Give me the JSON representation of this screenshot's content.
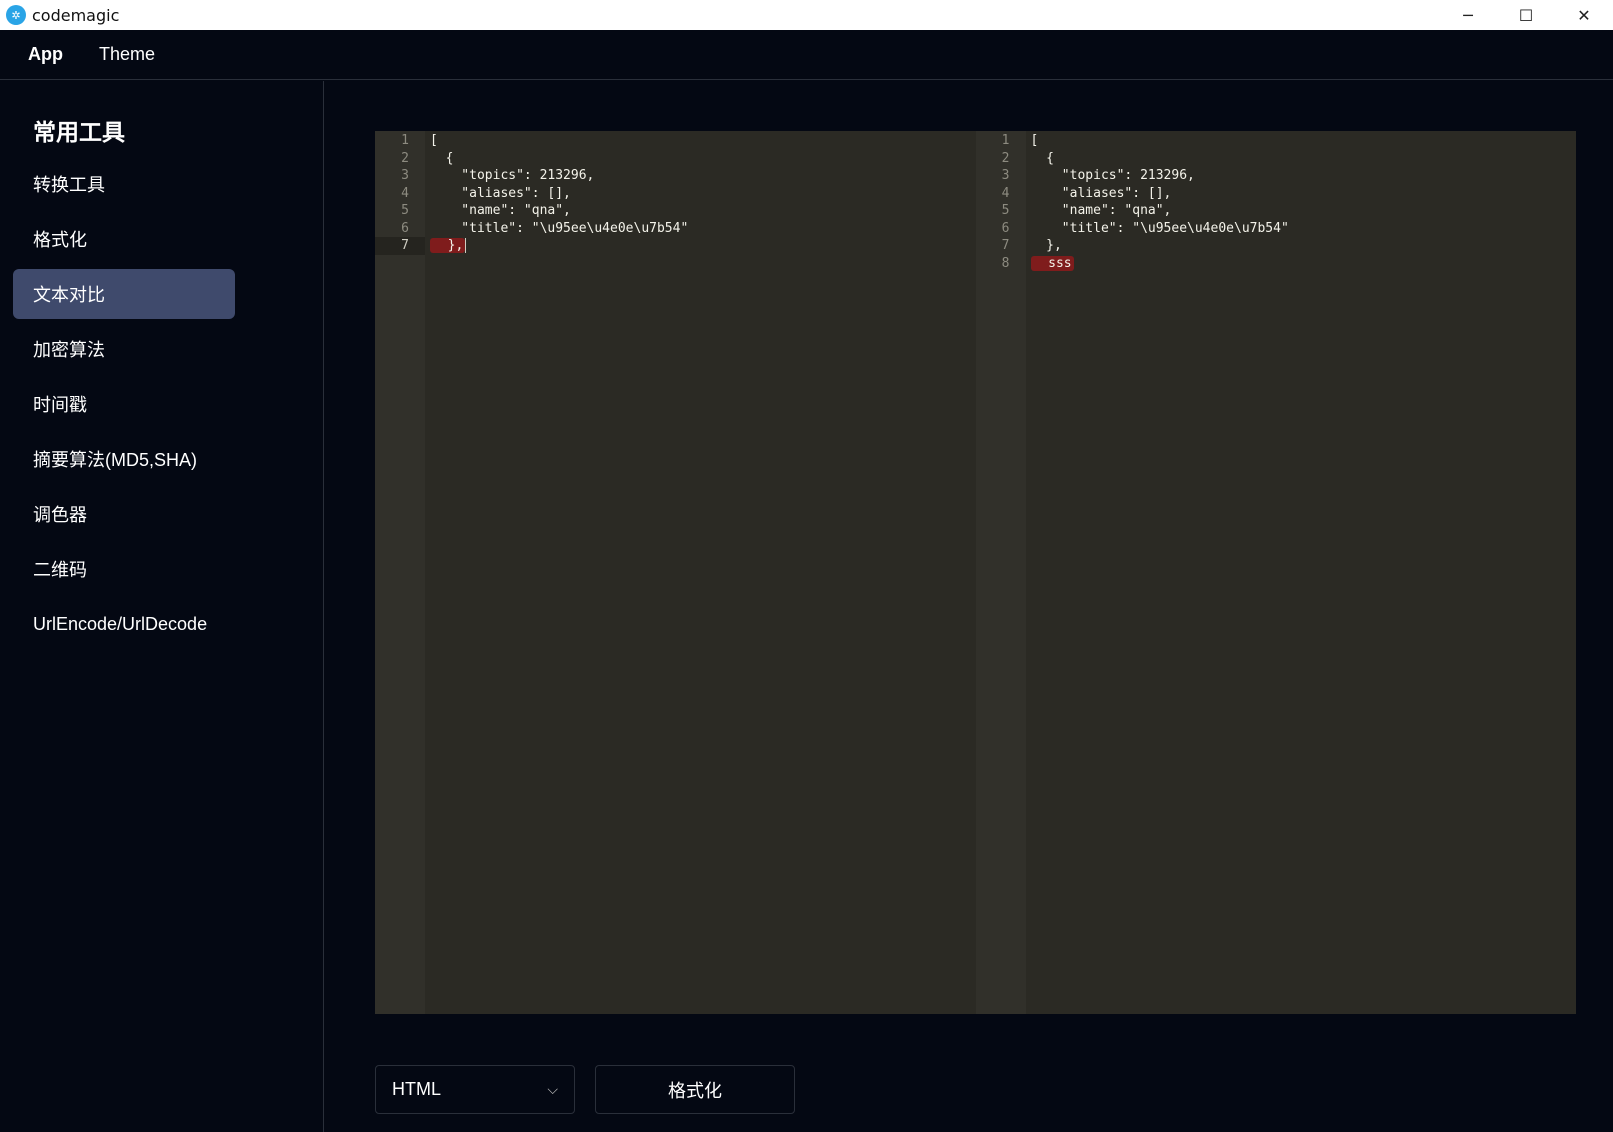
{
  "window": {
    "title": "codemagic",
    "logo_icon": "✲",
    "minimize_icon": "─",
    "maximize_icon": "☐",
    "close_icon": "✕"
  },
  "menubar": {
    "items": [
      "App",
      "Theme"
    ]
  },
  "sidebar": {
    "heading": "常用工具",
    "items": [
      "转换工具",
      "格式化",
      "文本对比",
      "加密算法",
      "时间戳",
      "摘要算法(MD5,SHA)",
      "调色器",
      "二维码",
      "UrlEncode/UrlDecode"
    ],
    "active_index": 2
  },
  "editor": {
    "left": {
      "lines": [
        "[",
        "  {",
        "    \"topics\": 213296,",
        "    \"aliases\": [],",
        "    \"name\": \"qna\",",
        "    \"title\": \"\\u95ee\\u4e0e\\u7b54\"",
        "  },"
      ],
      "diff_lines": [
        7
      ],
      "cursor_line": 7
    },
    "right": {
      "lines": [
        "[",
        "  {",
        "    \"topics\": 213296,",
        "    \"aliases\": [],",
        "    \"name\": \"qna\",",
        "    \"title\": \"\\u95ee\\u4e0e\\u7b54\"",
        "  },",
        "  sss"
      ],
      "diff_lines": [
        8
      ],
      "cursor_line": null
    }
  },
  "controls": {
    "language_select": "HTML",
    "chevron_icon": "⌵",
    "format_button": "格式化"
  },
  "colors": {
    "background": "#040813",
    "editor_bg": "#2b2a24",
    "active_nav": "#3f4a6c",
    "diff_highlight": "#7f1c1c"
  }
}
